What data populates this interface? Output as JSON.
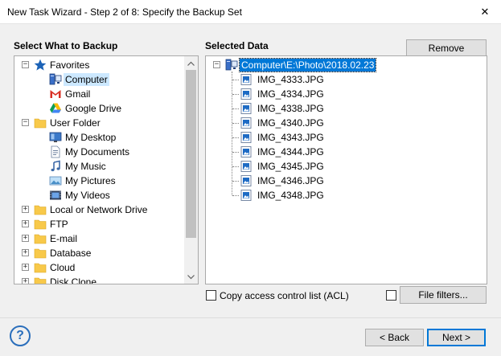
{
  "window": {
    "title": "New Task Wizard - Step 2 of 8: Specify the Backup Set",
    "close_glyph": "✕"
  },
  "left_panel": {
    "label": "Select What to Backup",
    "items": [
      {
        "label": "Favorites",
        "expander": "−",
        "icon": "star-icon"
      },
      {
        "label": "Computer",
        "icon": "computer-icon"
      },
      {
        "label": "Gmail",
        "icon": "gmail-icon"
      },
      {
        "label": "Google Drive",
        "icon": "google-drive-icon"
      },
      {
        "label": "User Folder",
        "expander": "−",
        "icon": "folder-icon"
      },
      {
        "label": "My Desktop",
        "icon": "desktop-icon"
      },
      {
        "label": "My Documents",
        "icon": "documents-icon"
      },
      {
        "label": "My Music",
        "icon": "music-icon"
      },
      {
        "label": "My Pictures",
        "icon": "pictures-icon"
      },
      {
        "label": "My Videos",
        "icon": "videos-icon"
      },
      {
        "label": "Local or Network Drive",
        "expander": "+",
        "icon": "folder-icon"
      },
      {
        "label": "FTP",
        "expander": "+",
        "icon": "folder-icon"
      },
      {
        "label": "E-mail",
        "expander": "+",
        "icon": "folder-icon"
      },
      {
        "label": "Database",
        "expander": "+",
        "icon": "folder-icon"
      },
      {
        "label": "Cloud",
        "expander": "+",
        "icon": "folder-icon"
      },
      {
        "label": "Disk Clone",
        "expander": "+",
        "icon": "folder-icon"
      }
    ]
  },
  "right_panel": {
    "label": "Selected Data",
    "remove_label": "Remove",
    "root": {
      "label": "Computer\\E:\\Photo\\2018.02.23",
      "expander": "−"
    },
    "files": [
      "IMG_4333.JPG",
      "IMG_4334.JPG",
      "IMG_4338.JPG",
      "IMG_4340.JPG",
      "IMG_4343.JPG",
      "IMG_4344.JPG",
      "IMG_4345.JPG",
      "IMG_4346.JPG",
      "IMG_4348.JPG"
    ]
  },
  "options": {
    "acl_label": "Copy access control list (ACL)",
    "file_filters_label": "File filters..."
  },
  "footer": {
    "help_glyph": "?",
    "back_label": "< Back",
    "next_label": "Next >"
  },
  "colors": {
    "selection": "#0078d7",
    "folder": "#f8c94a",
    "accent_blue": "#2a6ebb"
  }
}
